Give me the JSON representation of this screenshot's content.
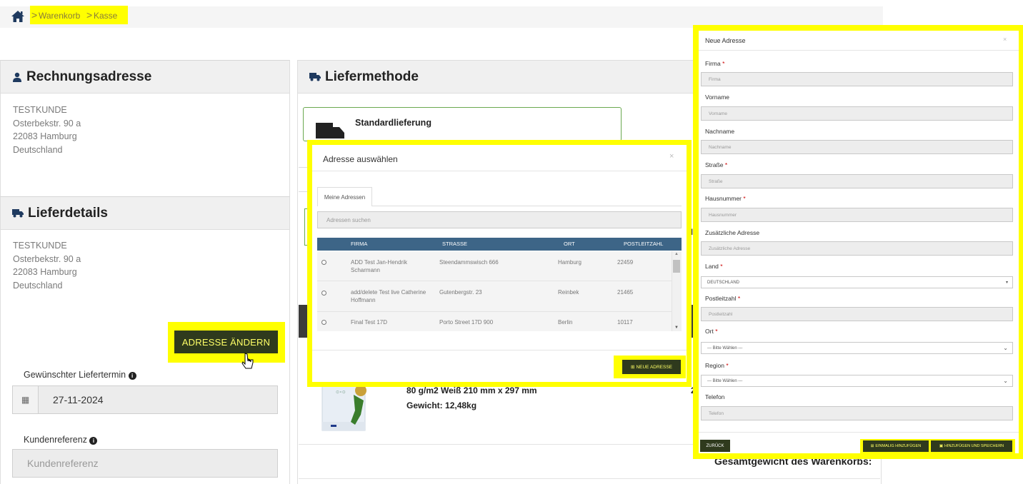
{
  "breadcrumb": {
    "items": [
      "Warenkorb",
      "Kasse"
    ],
    "separator": ">"
  },
  "billing": {
    "title": "Rechnungsadresse",
    "address": [
      "TESTKUNDE",
      "Osterbekstr. 90 a",
      "22083 Hamburg",
      "Deutschland"
    ]
  },
  "delivery": {
    "title": "Lieferdetails",
    "address": [
      "TESTKUNDE",
      "Osterbekstr. 90 a",
      "22083 Hamburg",
      "Deutschland"
    ],
    "change_button": "ADRESSE ÄNDERN",
    "date_label": "Gewünschter Liefertermin",
    "date_value": "27-11-2024",
    "reference_label": "Kundenreferenz",
    "reference_placeholder": "Kundenreferenz"
  },
  "shipping": {
    "title": "Liefermethode",
    "option": "Standardlieferung"
  },
  "product": {
    "line": "80 g/m2 Weiß 210 mm x 297 mm",
    "weight_label": "Gewicht:",
    "weight_value": "12,48kg",
    "total_weight_label": "Gesamtgewicht des Warenkorbs:"
  },
  "select_modal": {
    "title": "Adresse auswählen",
    "close": "×",
    "tab": "Meine Adressen",
    "search_placeholder": "Adressen suchen",
    "columns": [
      "FIRMA",
      "STRASSE",
      "ORT",
      "POSTLEITZAHL"
    ],
    "rows": [
      {
        "firma": "ADD Test Jan-Hendrik Scharmann",
        "strasse": "Steendammswisch 666",
        "ort": "Hamburg",
        "plz": "22459"
      },
      {
        "firma": "add/delete Test live Catherine Hoffmann",
        "strasse": "Gutenbergstr. 23",
        "ort": "Reinbek",
        "plz": "21465"
      },
      {
        "firma": "Final Test 17D",
        "strasse": "Porto Street 17D 900",
        "ort": "Berlin",
        "plz": "10117"
      }
    ],
    "new_address_button": "NEUE ADRESSE"
  },
  "new_modal": {
    "title": "Neue Adresse",
    "close": "×",
    "fields": {
      "firma": {
        "label": "Firma",
        "placeholder": "Firma"
      },
      "vorname": {
        "label": "Vorname",
        "placeholder": "Vorname"
      },
      "nachname": {
        "label": "Nachname",
        "placeholder": "Nachname"
      },
      "strasse": {
        "label": "Straße",
        "placeholder": "Straße"
      },
      "hausnummer": {
        "label": "Hausnummer",
        "placeholder": "Hausnummer"
      },
      "zusatz": {
        "label": "Zusätzliche Adresse",
        "placeholder": "Zusätzliche Adresse"
      },
      "land": {
        "label": "Land",
        "value": "DEUTSCHLAND"
      },
      "plz": {
        "label": "Postleitzahl",
        "placeholder": "Postleitzahl"
      },
      "ort": {
        "label": "Ort",
        "value": "--- Bitte Wählen ---"
      },
      "region": {
        "label": "Region",
        "value": "--- Bitte Wählen ---"
      },
      "telefon": {
        "label": "Telefon",
        "placeholder": "Telefon"
      }
    },
    "required_mark": "*",
    "back_button": "ZURÜCK",
    "add_once_button": "EINMALIG HINZUFÜGEN",
    "add_save_button": "HINZUFÜGEN UND SPEICHERN"
  },
  "colors": {
    "highlight": "#ffff00",
    "button_bg": "#2f3a1d",
    "button_text": "#ffff66",
    "table_header": "#3d6587",
    "card_border": "#6aa84f"
  }
}
